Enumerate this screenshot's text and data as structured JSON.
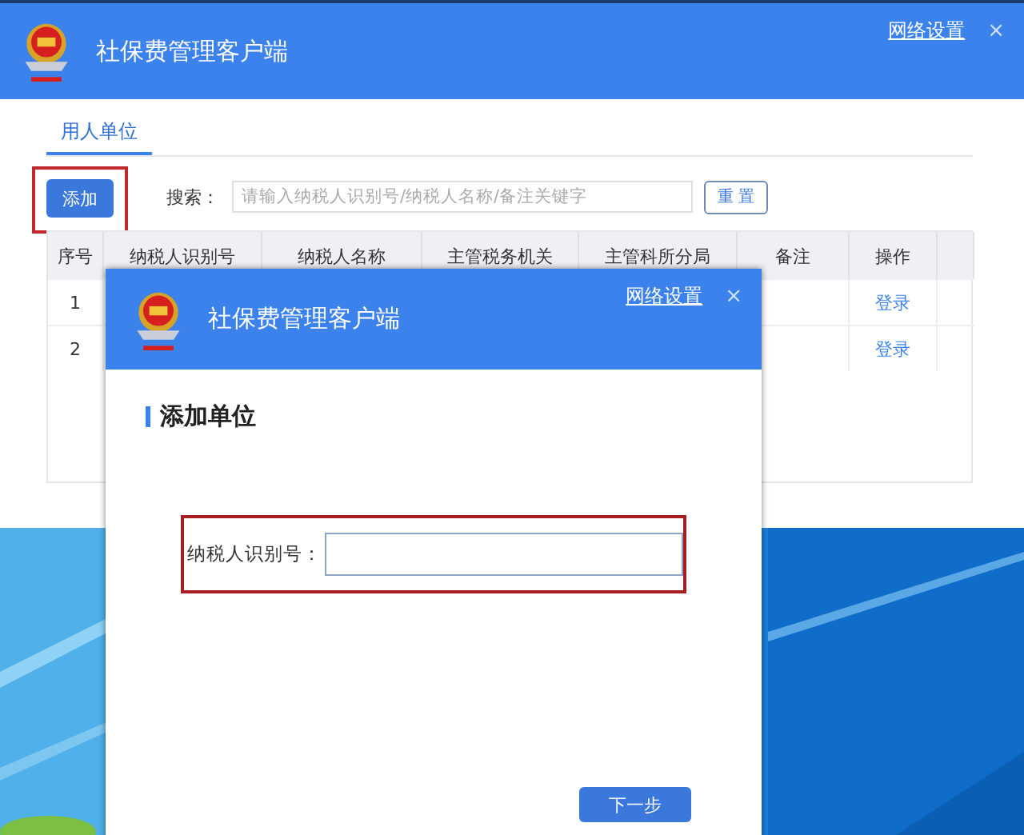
{
  "main_window": {
    "title": "社保费管理客户端",
    "network_link": "网络设置",
    "close": "×"
  },
  "tabs": [
    {
      "label": "用人单位",
      "selected": true
    }
  ],
  "toolbar": {
    "add_button": "添加",
    "search_label": "搜索：",
    "search_placeholder": "请输入纳税人识别号/纳税人名称/备注关键字",
    "reset_button": "重 置"
  },
  "table": {
    "columns": [
      "序号",
      "纳税人识别号",
      "纳税人名称",
      "主管税务机关",
      "主管科所分局",
      "备注",
      "操作"
    ],
    "rows": [
      {
        "index": "1",
        "action": "登录"
      },
      {
        "index": "2",
        "action": "登录"
      }
    ]
  },
  "dialog": {
    "title": "社保费管理客户端",
    "network_link": "网络设置",
    "close": "×",
    "heading": "添加单位",
    "field_label": "纳税人识别号：",
    "next_button": "下一步"
  }
}
